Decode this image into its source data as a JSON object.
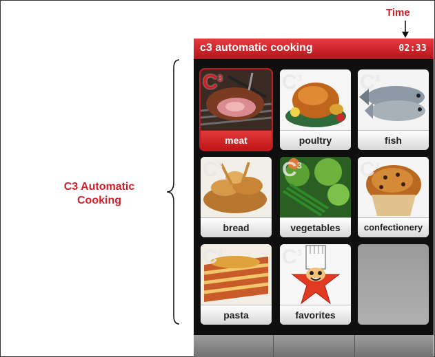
{
  "annotation": {
    "time_label": "Time",
    "section_label": "C3 Automatic Cooking"
  },
  "device": {
    "title": "c3 automatic cooking",
    "clock": "02:33",
    "badge": "C",
    "badge_sup": "3",
    "tiles": [
      {
        "label": "meat",
        "icon": "meat-photo",
        "selected": true
      },
      {
        "label": "poultry",
        "icon": "roast-chicken-photo",
        "selected": false
      },
      {
        "label": "fish",
        "icon": "fish-photo",
        "selected": false
      },
      {
        "label": "bread",
        "icon": "bread-photo",
        "selected": false
      },
      {
        "label": "vegetables",
        "icon": "vegetables-photo",
        "selected": false
      },
      {
        "label": "confectionery",
        "icon": "muffin-photo",
        "selected": false
      },
      {
        "label": "pasta",
        "icon": "lasagna-photo",
        "selected": false
      },
      {
        "label": "favorites",
        "icon": "chef-star-mascot",
        "selected": false
      },
      {
        "label": "",
        "icon": "",
        "selected": false
      }
    ]
  },
  "colors": {
    "accent": "#d1202a",
    "header": "#c41a1f",
    "screen_bg": "#0f0f0f"
  }
}
